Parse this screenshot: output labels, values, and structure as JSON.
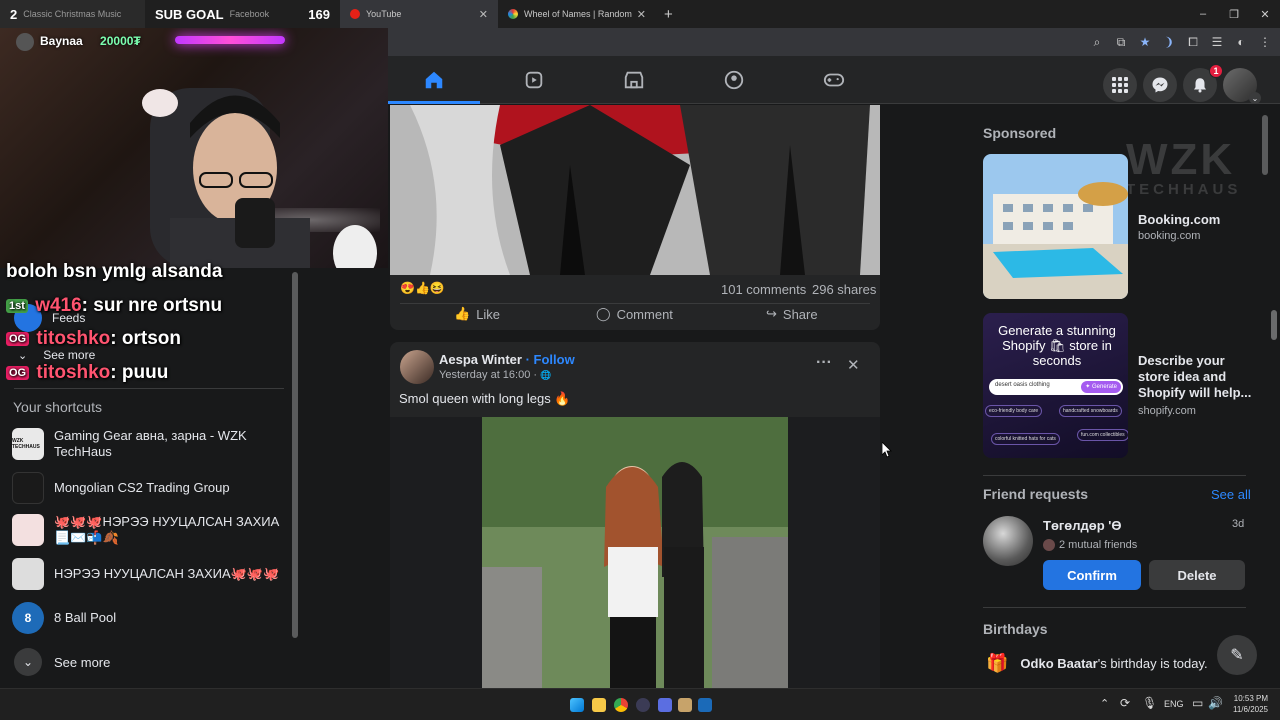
{
  "browser": {
    "tabs": [
      {
        "label": "Classic Christmas Music",
        "count": "2"
      },
      {
        "label": "Facebook"
      },
      {
        "label": "YouTube"
      },
      {
        "label": "Wheel of Names | Random nam"
      }
    ],
    "new_tab": "+",
    "window": {
      "minimize": "–",
      "restore": "❐",
      "close": "✕"
    }
  },
  "stream": {
    "sub_goal_label": "SUB GOAL",
    "sub_goal_count": "169",
    "donor_name": "Baynaa",
    "donor_amount": "20000₮",
    "chat": [
      {
        "user": "",
        "message": "boloh bsn ymlg alsanda"
      },
      {
        "user": "w416",
        "badges": "1st",
        "message": "sur nre ortsnu"
      },
      {
        "user": "titoshko",
        "badges": "OG",
        "message": "ortson"
      },
      {
        "user": "titoshko",
        "badges": "OG",
        "message": "puuu"
      }
    ]
  },
  "left": {
    "feeds": "Feeds",
    "see_more_top": "See more",
    "shortcuts_title": "Your shortcuts",
    "shortcuts": [
      {
        "label": "Gaming Gear авна, зарна - WZK TechHaus",
        "icon": "WZK TECHHAUS",
        "color": "#e9e9e9"
      },
      {
        "label": "Mongolian CS2 Trading Group",
        "icon": "",
        "color": "#1a1a1a"
      },
      {
        "label": "🐙🐙🐙НЭРЭЭ НУУЦАЛСАН ЗАХИА 📃✉️📬🍂",
        "icon": "",
        "color": "#f3e0e0"
      },
      {
        "label": "НЭРЭЭ НУУЦАЛСАН ЗАХИА🐙🐙🐙",
        "icon": "",
        "color": "#ddd"
      },
      {
        "label": "8 Ball Pool",
        "icon": "8",
        "color": "#1e6bb8"
      }
    ],
    "see_more_bottom": "See more"
  },
  "post1": {
    "reactions": "😍👍😆",
    "comments": "101 comments",
    "shares": "296 shares",
    "actions": {
      "like": "Like",
      "comment": "Comment",
      "share": "Share"
    }
  },
  "post2": {
    "author": "Aespa Winter",
    "dot": " · ",
    "follow": "Follow",
    "time": "Yesterday at 16:00 · ",
    "globe": "🌐",
    "text": "Smol queen with long legs 🔥",
    "more": "···",
    "close": "✕"
  },
  "right": {
    "sponsored_title": "Sponsored",
    "ads": [
      {
        "title": "Booking.com",
        "domain": "booking.com"
      },
      {
        "title": "Describe your store idea and Shopify will help...",
        "domain": "shopify.com",
        "creative": {
          "headline": "Generate a stunning Shopify 🛍 store in seconds",
          "input": "desert oasis clothing",
          "button": "✦ Generate",
          "chips": [
            "eco-friendly body care",
            "handcrafted snowboards",
            "fun.com collectibles",
            "colorful knitted hats for cats"
          ]
        }
      }
    ],
    "watermark_line1": "WZK",
    "watermark_line2": "TECHHAUS",
    "friend_requests_title": "Friend requests",
    "see_all": "See all",
    "request": {
      "name": "Төгөлдөр 'Ө",
      "age": "3d",
      "mutual": "2 mutual friends",
      "confirm": "Confirm",
      "delete": "Delete"
    },
    "birthdays_title": "Birthdays",
    "birthday": {
      "name": "Odko Baatar",
      "text": "'s birthday is today."
    }
  },
  "nav": {
    "notification_count": "1"
  },
  "taskbar": {
    "lang": "ENG",
    "time": "10:53 PM",
    "date": "11/6/2025"
  },
  "colors": {
    "accent": "#2d88ff",
    "fb_blue": "#2374e1",
    "surface": "#242526",
    "bg": "#18191a",
    "chat_name": "#ff5470"
  }
}
